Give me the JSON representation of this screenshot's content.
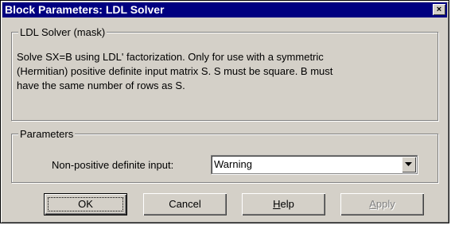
{
  "window": {
    "title": "Block Parameters: LDL Solver",
    "close_glyph": "×"
  },
  "mask": {
    "legend": "LDL Solver (mask)",
    "description_lines": [
      "Solve SX=B using LDL' factorization.  Only for use with a symmetric",
      "(Hermitian) positive definite input matrix S.  S must be square.  B must",
      "have the same number of rows as S."
    ]
  },
  "parameters": {
    "legend": "Parameters",
    "nonpos_label": "Non-positive definite input:",
    "nonpos_value": "Warning"
  },
  "buttons": {
    "ok": "OK",
    "cancel": "Cancel",
    "help_first": "H",
    "help_rest": "elp",
    "apply_first": "A",
    "apply_rest": "pply"
  }
}
